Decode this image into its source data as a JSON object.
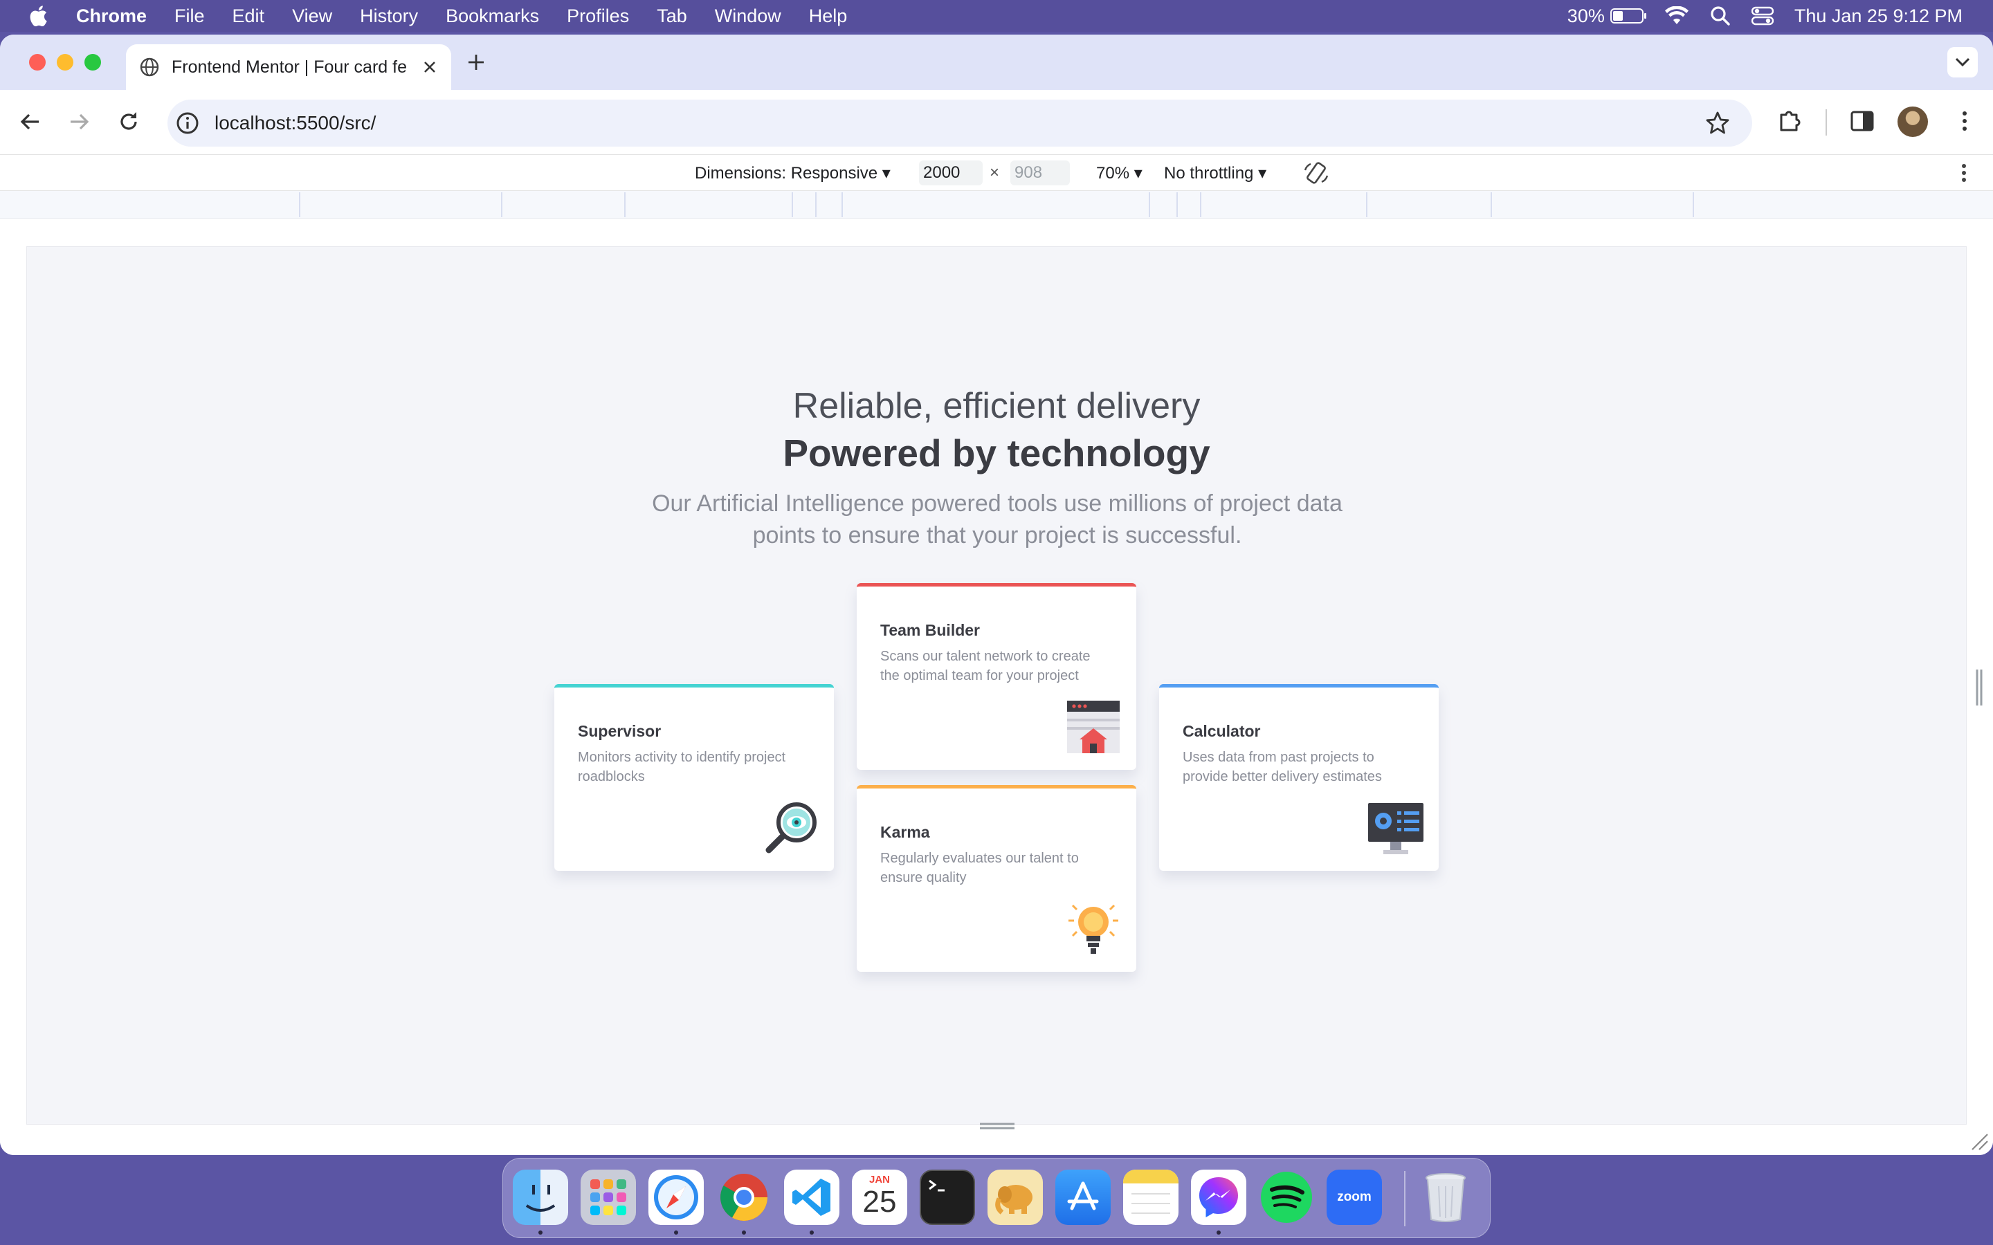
{
  "menubar": {
    "app": "Chrome",
    "items": [
      "File",
      "Edit",
      "View",
      "History",
      "Bookmarks",
      "Profiles",
      "Tab",
      "Window",
      "Help"
    ],
    "battery": "30%",
    "datetime": "Thu Jan 25  9:12 PM"
  },
  "browser": {
    "tab_title": "Frontend Mentor | Four card fe",
    "url": "localhost:5500/src/"
  },
  "devtools": {
    "dimensions_label": "Dimensions: Responsive",
    "width": "2000",
    "times": "×",
    "height": "908",
    "zoom": "70%",
    "throttling": "No throttling"
  },
  "page": {
    "heading_light": "Reliable, efficient delivery",
    "heading_bold": "Powered by technology",
    "description": "Our Artificial Intelligence powered tools use millions of project data points to ensure that your project is successful.",
    "cards": [
      {
        "title": "Supervisor",
        "description": "Monitors activity to identify project roadblocks",
        "accent": "#44d3d2",
        "icon": "supervisor-icon"
      },
      {
        "title": "Team Builder",
        "description": "Scans our talent network to create the optimal team for your project",
        "accent": "#ea5454",
        "icon": "team-builder-icon"
      },
      {
        "title": "Karma",
        "description": "Regularly evaluates our talent to ensure quality",
        "accent": "#fcaf4a",
        "icon": "karma-icon"
      },
      {
        "title": "Calculator",
        "description": "Uses data from past projects to provide better delivery estimates",
        "accent": "#549ef2",
        "icon": "calculator-icon"
      }
    ]
  },
  "dock": {
    "calendar_month": "JAN",
    "calendar_day": "25",
    "zoom_label": "zoom",
    "apps": [
      "finder-icon",
      "launchpad-icon",
      "safari-icon",
      "chrome-icon",
      "vscode-icon",
      "calendar-icon",
      "terminal-icon",
      "tableplus-icon",
      "app-store-icon",
      "notes-icon",
      "messenger-icon",
      "spotify-icon",
      "zoom-icon",
      "trash-icon"
    ]
  }
}
